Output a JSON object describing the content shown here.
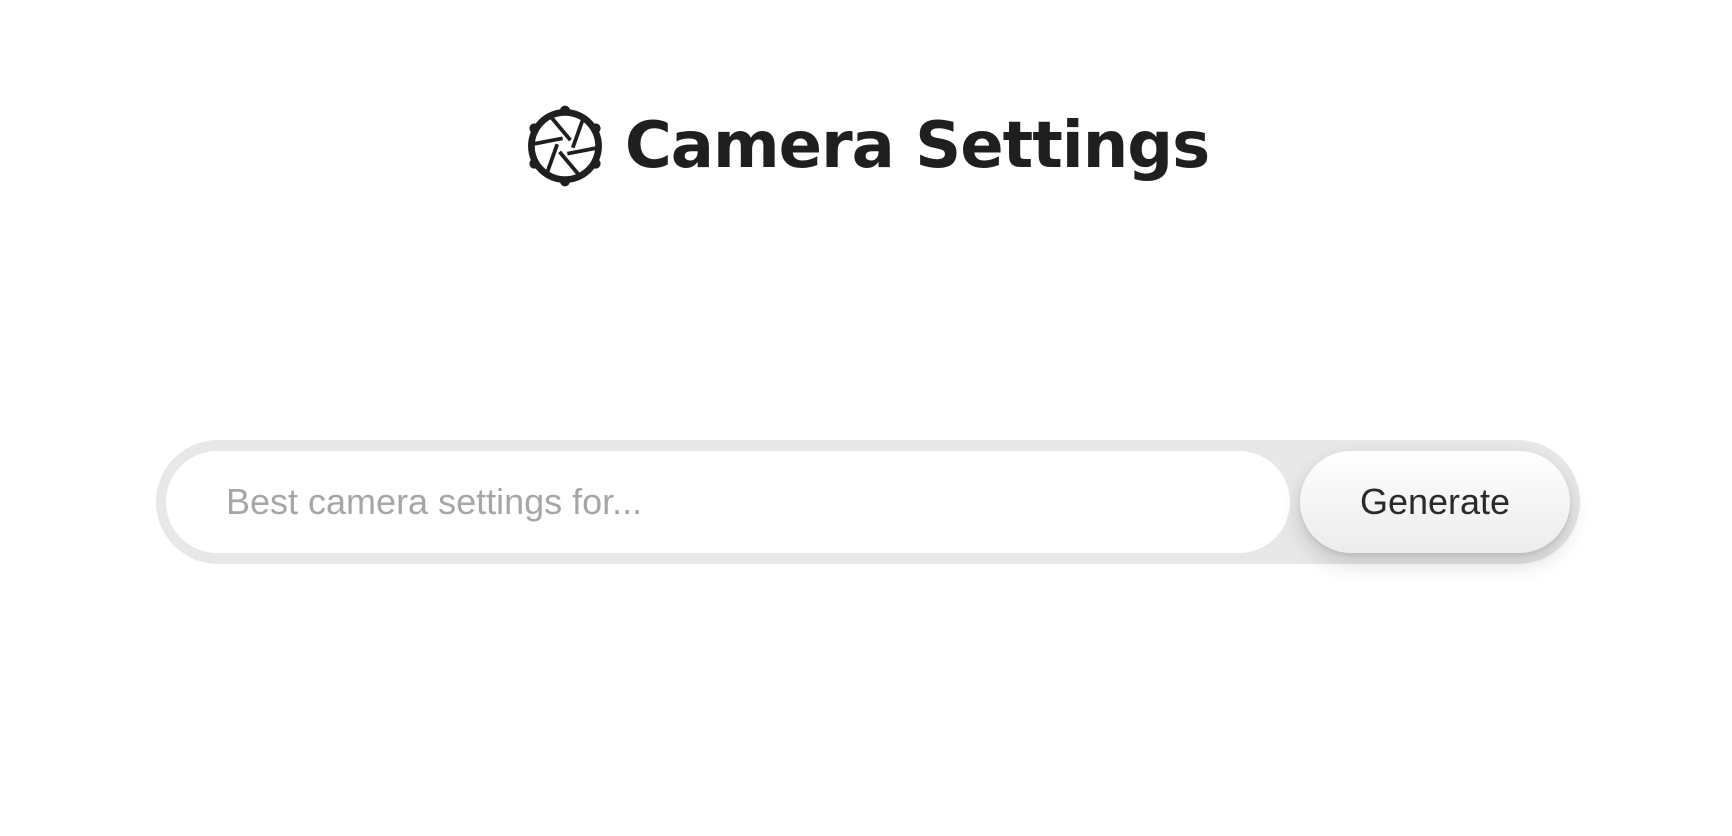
{
  "header": {
    "title": "Camera Settings",
    "logo_icon": "camera-aperture-gear-icon"
  },
  "search": {
    "placeholder": "Best camera settings for...",
    "value": "",
    "button_label": "Generate"
  },
  "colors": {
    "background": "#ffffff",
    "title": "#1f1f1f",
    "search_shell": "#e8e8e8",
    "placeholder": "#a6a6a6",
    "button_text": "#2a2a2a"
  }
}
